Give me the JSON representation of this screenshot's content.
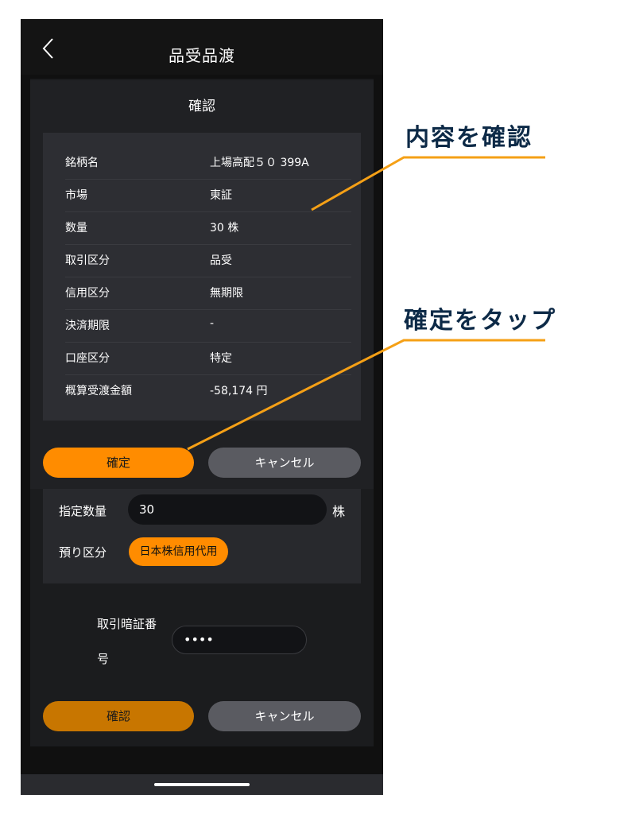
{
  "header": {
    "title": "品受品渡"
  },
  "modal": {
    "title": "確認",
    "rows": [
      {
        "label": "銘柄名",
        "value": "上場高配５０ 399A"
      },
      {
        "label": "市場",
        "value": "東証"
      },
      {
        "label": "数量",
        "value": "30 株"
      },
      {
        "label": "取引区分",
        "value": "品受"
      },
      {
        "label": "信用区分",
        "value": "無期限"
      },
      {
        "label": "決済期限",
        "value": "-"
      },
      {
        "label": "口座区分",
        "value": "特定"
      },
      {
        "label": "概算受渡金額",
        "value": "-58,174 円"
      }
    ],
    "confirm_label": "確定",
    "cancel_label": "キャンセル"
  },
  "form": {
    "quantity_label": "指定数量",
    "quantity_value": "30",
    "quantity_unit": "株",
    "deposit_label": "預り区分",
    "deposit_value": "日本株信用代用",
    "pin_label_line1": "取引暗証番",
    "pin_label_line2": "号",
    "pin_value": "••••",
    "confirm_label": "確認",
    "cancel_label": "キャンセル"
  },
  "annotations": {
    "content_check": "内容を確認",
    "tap_confirm": "確定をタップ",
    "line_color": "#f5a016"
  },
  "colors": {
    "accent": "#ff8c00",
    "background": "#101010"
  }
}
